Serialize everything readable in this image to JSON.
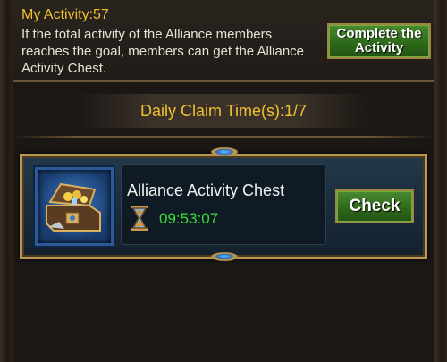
{
  "activity": {
    "title": "My Activity:57",
    "description": "If the total activity of the Alliance members reaches the goal, members can get the Alliance Activity Chest.",
    "complete_button": "Complete the Activity"
  },
  "claim": {
    "label": "Daily Claim Time(s):1/7"
  },
  "chest": {
    "name": "Alliance Activity Chest",
    "timer": "09:53:07",
    "check_button": "Check",
    "icon": "treasure-chest-icon",
    "timer_icon": "hourglass-icon"
  },
  "colors": {
    "accent_gold": "#f0c030",
    "timer_green": "#33e033",
    "button_green": "#2e6a1a"
  }
}
